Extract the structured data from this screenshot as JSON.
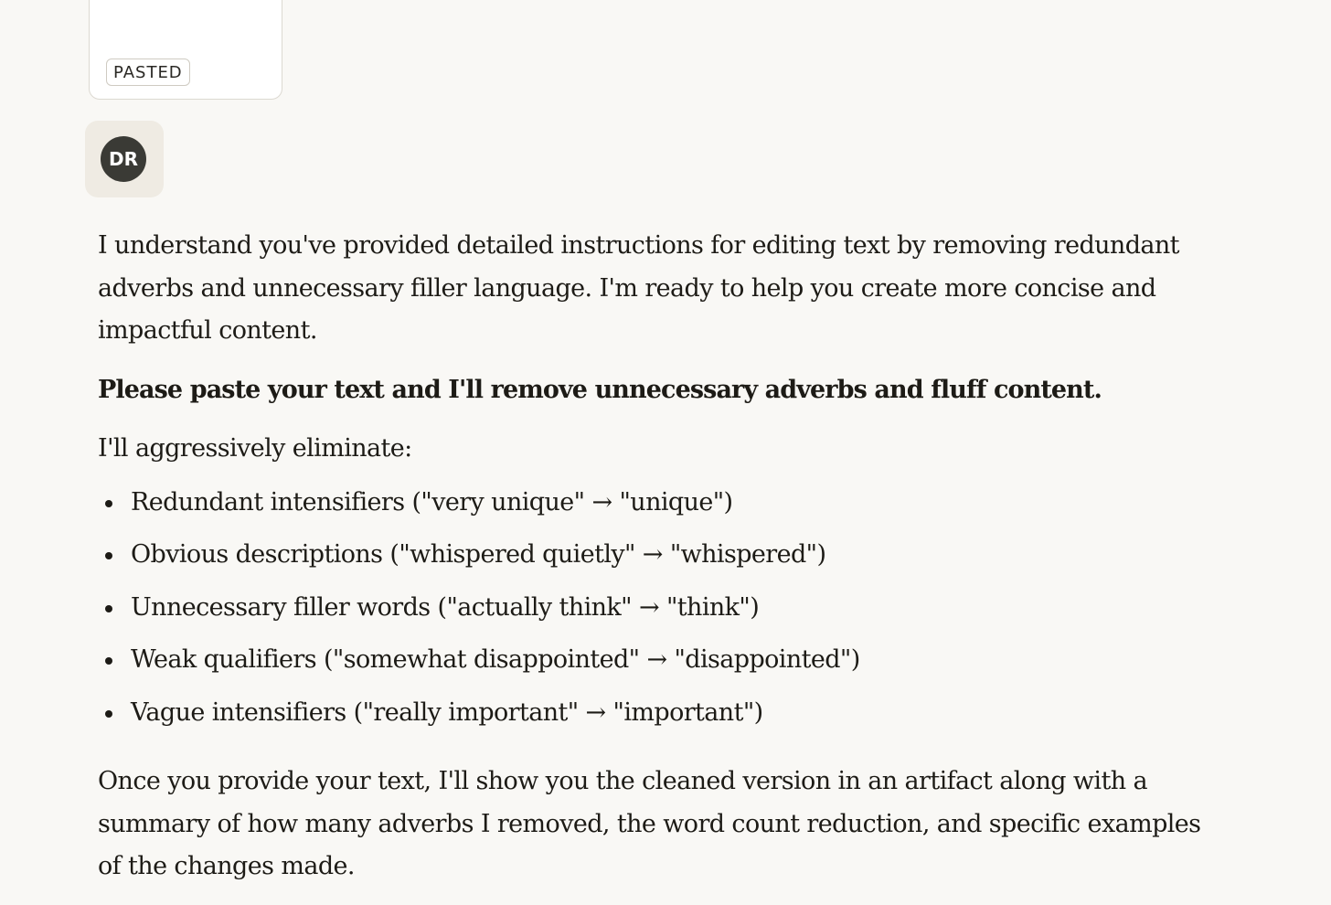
{
  "attachment": {
    "badge_label": "PASTED"
  },
  "avatar": {
    "initials": "DR"
  },
  "response": {
    "intro": "I understand you've provided detailed instructions for editing text by removing redundant adverbs and unnecessary filler language. I'm ready to help you create more concise and impactful content.",
    "bold_prompt": "Please paste your text and I'll remove unnecessary adverbs and fluff content.",
    "list_lead": "I'll aggressively eliminate:",
    "bullets": [
      "Redundant intensifiers (\"very unique\" → \"unique\")",
      "Obvious descriptions (\"whispered quietly\" → \"whispered\")",
      "Unnecessary filler words (\"actually think\" → \"think\")",
      "Weak qualifiers (\"somewhat disappointed\" → \"disappointed\")",
      "Vague intensifiers (\"really important\" → \"important\")"
    ],
    "closing": "Once you provide your text, I'll show you the cleaned version in an artifact along with a summary of how many adverbs I removed, the word count reduction, and specific examples of the changes made."
  }
}
